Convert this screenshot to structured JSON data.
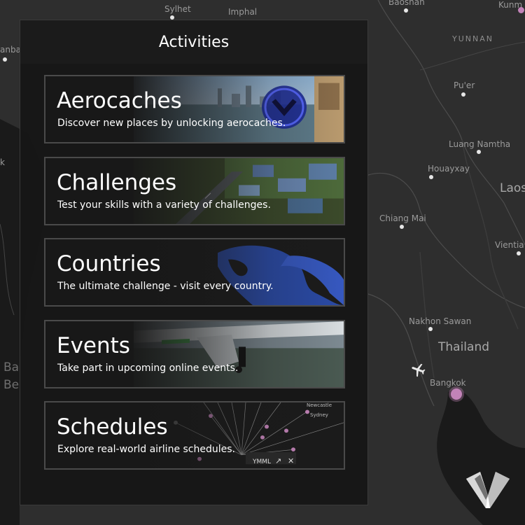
{
  "panel": {
    "title": "Activities"
  },
  "activities": [
    {
      "title": "Aerocaches",
      "description": "Discover new places by unlocking aerocaches."
    },
    {
      "title": "Challenges",
      "description": "Test your skills with a variety of challenges."
    },
    {
      "title": "Countries",
      "description": "The ultimate challenge - visit every country."
    },
    {
      "title": "Events",
      "description": "Take part in upcoming online events."
    },
    {
      "title": "Schedules",
      "description": "Explore real-world airline schedules."
    }
  ],
  "schedules_card": {
    "airport_code": "YMML",
    "city_newcastle": "Newcastle",
    "city_sydney": "Sydney"
  },
  "map": {
    "labels": {
      "sylhet": "Sylhet",
      "imphal": "Imphal",
      "baoshan": "Baoshan",
      "kunming": "Kunm",
      "yunnan": "YUNNAN",
      "anba": "anba",
      "puer": "Pu'er",
      "luang_namtha": "Luang Namtha",
      "houayxay": "Houayxay",
      "laos": "Laos",
      "chiang_mai": "Chiang Mai",
      "vientiane": "Vientia",
      "nakhon_sawan": "Nakhon Sawan",
      "thailand": "Thailand",
      "bangkok": "Bangkok",
      "ba": "Ba",
      "be": "Be",
      "k": "k"
    },
    "icons": [
      "airplane-icon",
      "location-pin-icon"
    ]
  },
  "colors": {
    "pin": "#c283b8",
    "panel_bg": "#161616",
    "map_land": "#2e2e2e",
    "map_water": "#151515"
  }
}
